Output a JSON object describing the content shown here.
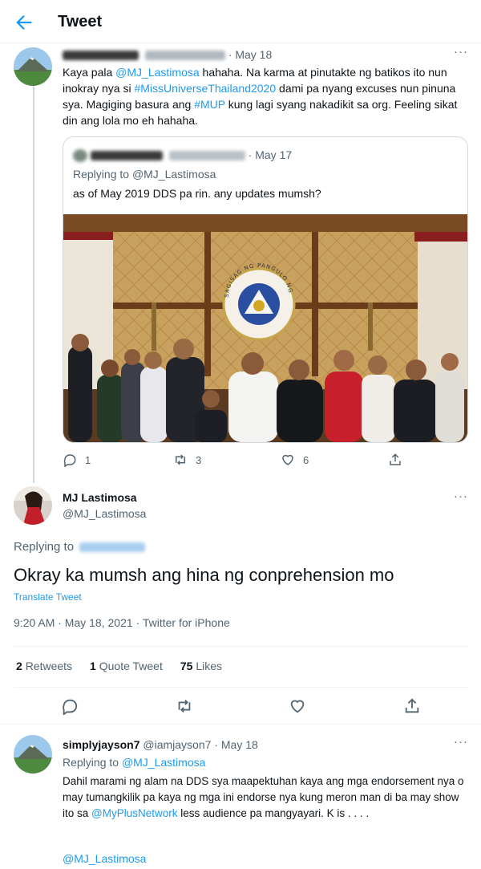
{
  "header": {
    "title": "Tweet",
    "back_icon": "back-arrow-icon"
  },
  "colors": {
    "accent": "#1d9bf0",
    "text": "#0f1419",
    "secondary": "#536471",
    "border": "#cfd9de"
  },
  "parent_tweet": {
    "date": "May 18",
    "text_parts": [
      "Kaya pala ",
      "@MJ_Lastimosa",
      " hahaha. Na karma at pinutakte ng batikos ito nun inokray nya si ",
      "#MissUniverseThailand2020",
      " dami pa nyang excuses nun pinuna sya. Magiging basura ang ",
      "#MUP",
      " kung lagi syang nakadikit sa org. Feeling sikat din ang lola mo eh hahaha."
    ],
    "quote": {
      "date": "May 17",
      "replying_to_label": "Replying to ",
      "replying_to_handle": "@MJ_Lastimosa",
      "text": "as of May 2019 DDS pa rin. any updates mumsh?",
      "photo_seal_text": "SAGISAG NG PANGULO NG PILIPINAS"
    },
    "actions": {
      "replies": "1",
      "retweets": "3",
      "likes": "6"
    }
  },
  "main_tweet": {
    "name": "MJ Lastimosa",
    "handle": "@MJ_Lastimosa",
    "replying_to_label": "Replying to",
    "text": "Okray ka mumsh ang hina ng conprehension mo",
    "translate_label": "Translate Tweet",
    "meta": "9:20 AM · May 18, 2021 · Twitter for iPhone",
    "stats": {
      "retweets_count": "2",
      "retweets_label": "Retweets",
      "quotes_count": "1",
      "quotes_label": "Quote Tweet",
      "likes_count": "75",
      "likes_label": "Likes"
    }
  },
  "reply_tweet": {
    "name": "simplyjayson7",
    "handle": "@iamjayson7",
    "date": "May 18",
    "replying_to_label": "Replying to ",
    "replying_to_handle": "@MJ_Lastimosa",
    "text_parts": [
      "Dahil marami ng alam na DDS sya maapektuhan kaya ang mga endorsement nya o may tumangkilik pa kaya ng mga ini endorse nya kung meron man di ba may show ito sa ",
      "@MyPlusNetwork",
      " less audience pa mangyayari. K is . . . ."
    ],
    "mention": "@MJ_Lastimosa"
  },
  "separator": " · ",
  "more_label": "···"
}
